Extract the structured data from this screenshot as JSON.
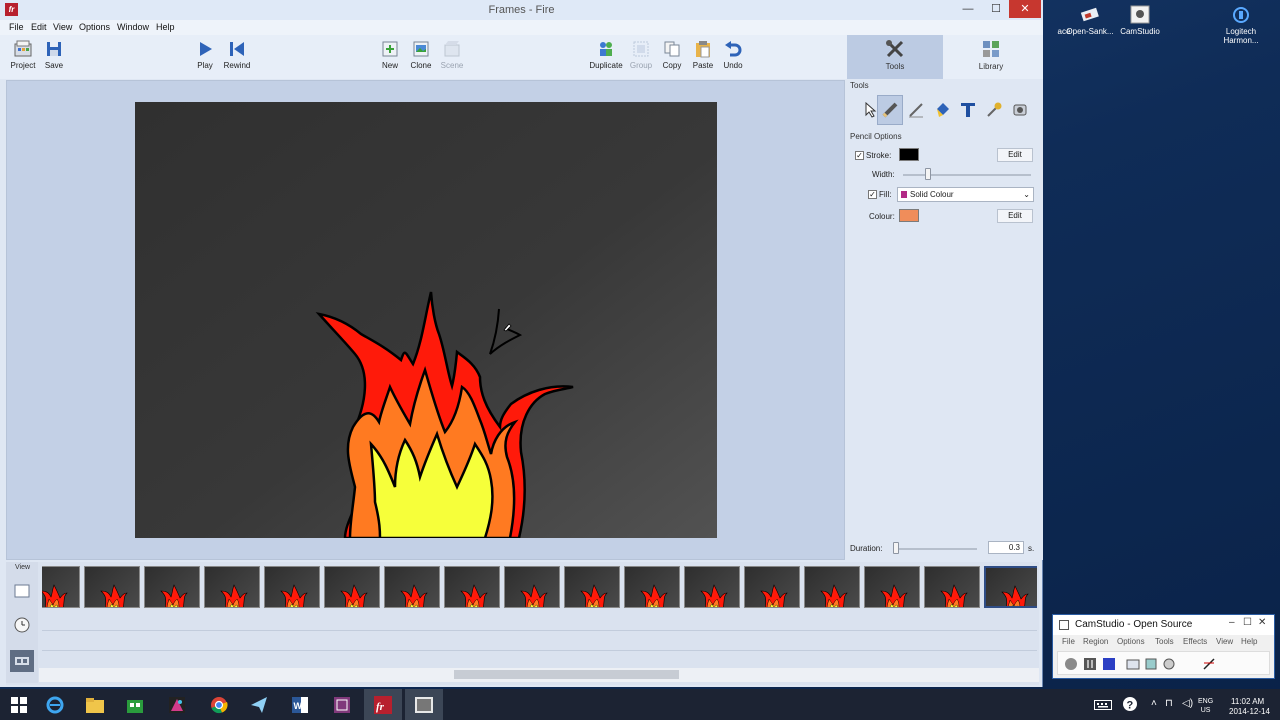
{
  "window": {
    "title": "Frames - Fire",
    "app_icon_text": "fr",
    "controls": {
      "minimize": "—",
      "maximize": "☐",
      "close": "✕"
    }
  },
  "menu": [
    "File",
    "Edit",
    "View",
    "Options",
    "Window",
    "Help"
  ],
  "toolbar": {
    "project": "Project",
    "save": "Save",
    "play": "Play",
    "rewind": "Rewind",
    "new": "New",
    "clone": "Clone",
    "scene": "Scene",
    "duplicate": "Duplicate",
    "group": "Group",
    "copy": "Copy",
    "paste": "Paste",
    "undo": "Undo"
  },
  "panel_tabs": {
    "tools": "Tools",
    "library": "Library",
    "active": "Tools"
  },
  "tools_panel": {
    "section": "Tools",
    "tool_icons": [
      "pointer-icon",
      "pencil-icon",
      "pen-icon",
      "paint-bucket-icon",
      "text-icon",
      "eyedropper-icon",
      "stamp-icon"
    ],
    "active_tool": "pencil-icon",
    "options_section": "Pencil Options",
    "stroke_label": "Stroke:",
    "stroke_checked": true,
    "stroke_color": "#000000",
    "edit_label": "Edit",
    "width_label": "Width:",
    "width_level": 0.18,
    "fill_label": "Fill:",
    "fill_checked": true,
    "fill_type": "Solid Colour",
    "fill_dot_color": "#b22a86",
    "colour_label": "Colour:",
    "colour_value": "#f08d5a",
    "duration_label": "Duration:",
    "duration_value": "0.3",
    "duration_unit": "s.",
    "duration_level": 0.0
  },
  "timeline": {
    "view_label": "View",
    "frame_count": 17,
    "selected_frame": 16
  },
  "desktop": {
    "items": [
      {
        "label": "ace",
        "icon": "folder-icon"
      },
      {
        "label": "Open-Sank...",
        "icon": "tool-icon"
      },
      {
        "label": "CamStudio",
        "icon": "camstudio-icon"
      },
      {
        "label": "Logitech Harmon...",
        "icon": "logitech-icon"
      }
    ]
  },
  "camstudio": {
    "title": "CamStudio - Open Source",
    "menu": [
      "File",
      "Region",
      "Options",
      "Tools",
      "Effects",
      "View",
      "Help"
    ]
  },
  "taskbar": {
    "apps": [
      "windows-start-icon",
      "internet-explorer-icon",
      "file-explorer-icon",
      "store-icon",
      "game-icon",
      "chrome-icon",
      "paper-plane-icon",
      "word-icon",
      "onenote-icon",
      "frames-icon",
      "camstudio-icon"
    ],
    "active_app": "frames-icon",
    "lang_1": "ENG",
    "lang_2": "US",
    "time": "11:02 AM",
    "date": "2014-12-14"
  },
  "colors": {
    "flame_outer": "#ff1a0a",
    "flame_mid": "#ff7a21",
    "flame_inner": "#f6ff3a",
    "canvas_bg": "#3a3a3a",
    "accent": "#bccbe3"
  }
}
